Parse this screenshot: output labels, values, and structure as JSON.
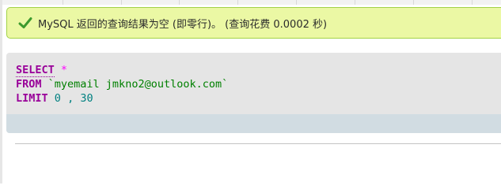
{
  "message": {
    "text": "MySQL 返回的查询结果为空 (即零行)。 (查询花费 0.0002 秒)",
    "icon": "check-icon",
    "accent": "#a2d246",
    "background": "#ebf8a4"
  },
  "sql": {
    "select_keyword": "SELECT",
    "select_star": "*",
    "from_keyword": "FROM",
    "table_name": "`myemail jmkno2@outlook.com`",
    "limit_keyword": "LIMIT",
    "limit_offset": "0",
    "limit_comma": ",",
    "limit_count": "30",
    "keyword_color": "#990099",
    "identifier_color": "#008000",
    "number_color": "#008080"
  }
}
